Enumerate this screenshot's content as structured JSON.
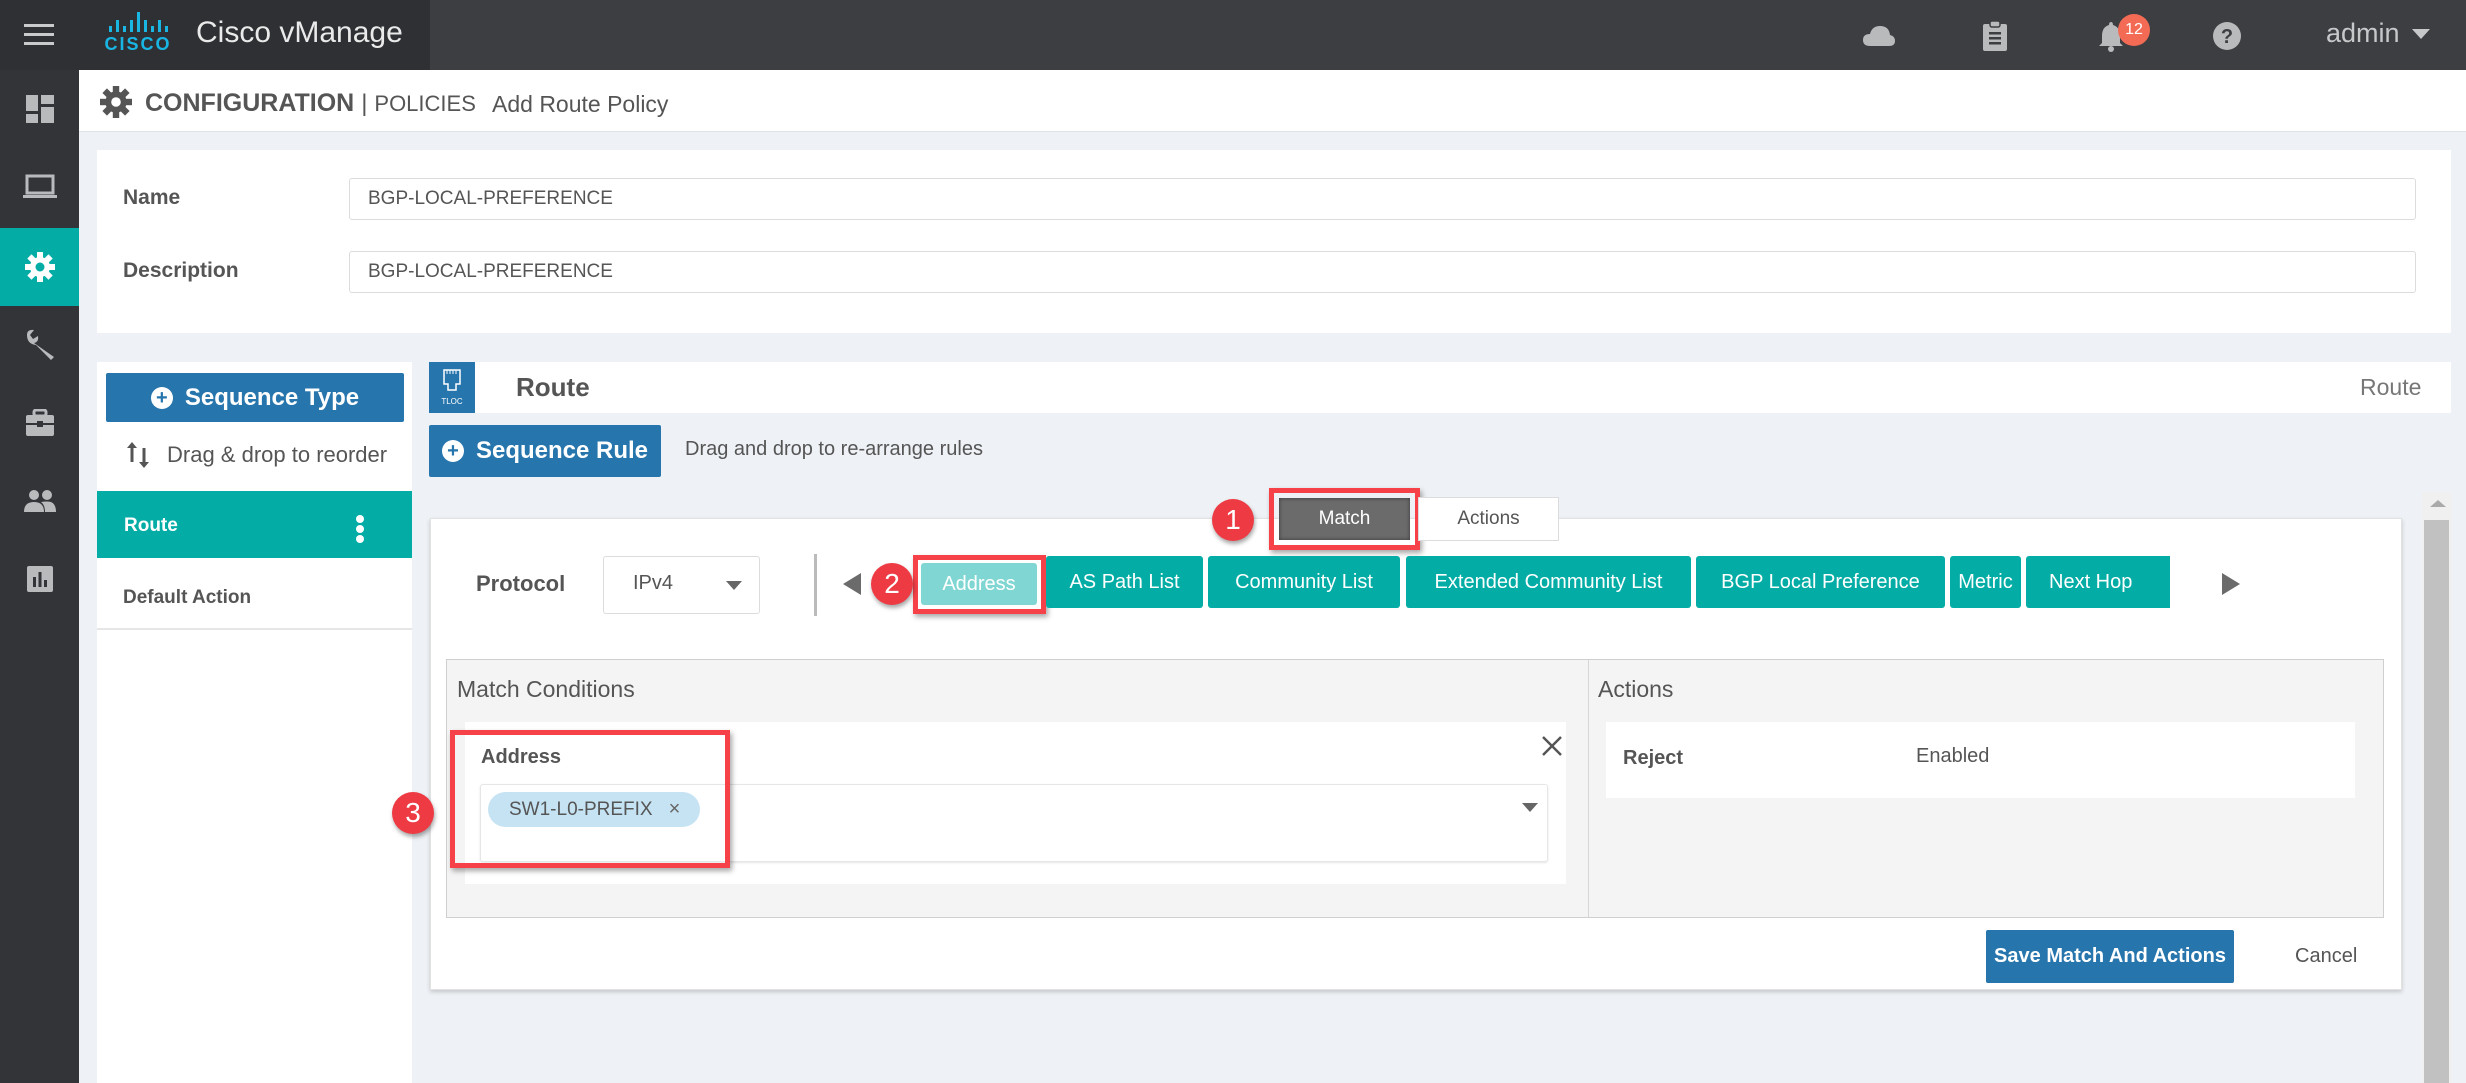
{
  "header": {
    "app_title": "Cisco vManage",
    "logo_word": "CISCO",
    "icons": [
      "cloud-icon",
      "clipboard-icon",
      "bell-icon",
      "help-icon"
    ],
    "notification_count": "12",
    "user": "admin"
  },
  "leftnav": {
    "items": [
      {
        "icon": "dashboard-icon",
        "active": false
      },
      {
        "icon": "monitor-icon",
        "active": false
      },
      {
        "icon": "gear-icon",
        "active": true
      },
      {
        "icon": "wrench-icon",
        "active": false
      },
      {
        "icon": "toolbox-icon",
        "active": false
      },
      {
        "icon": "users-icon",
        "active": false
      },
      {
        "icon": "analytics-icon",
        "active": false
      }
    ]
  },
  "breadcrumb": {
    "section": "CONFIGURATION",
    "separator": "|",
    "subsection": "POLICIES",
    "page": "Add Route Policy"
  },
  "form": {
    "name_label": "Name",
    "name_value": "BGP-LOCAL-PREFERENCE",
    "description_label": "Description",
    "description_value": "BGP-LOCAL-PREFERENCE"
  },
  "sequence_panel": {
    "sequence_type_button": "Sequence Type",
    "reorder_hint": "Drag & drop to reorder",
    "items": [
      {
        "label": "Route",
        "active": true
      },
      {
        "label": "Default Action",
        "active": false
      }
    ]
  },
  "route_section": {
    "icon_label": "TLOC",
    "title": "Route",
    "right_label": "Route",
    "sequence_rule_button": "Sequence Rule",
    "rearrange_hint": "Drag and drop to re-arrange rules"
  },
  "rule_editor": {
    "tabs": [
      {
        "label": "Match",
        "active": true
      },
      {
        "label": "Actions",
        "active": false
      }
    ],
    "protocol_label": "Protocol",
    "protocol_value": "IPv4",
    "match_buttons": [
      {
        "label": "Address",
        "selected": true
      },
      {
        "label": "AS Path List",
        "selected": false
      },
      {
        "label": "Community List",
        "selected": false
      },
      {
        "label": "Extended Community List",
        "selected": false
      },
      {
        "label": "BGP Local Preference",
        "selected": false
      },
      {
        "label": "Metric",
        "selected": false
      },
      {
        "label": "Next Hop",
        "selected": false
      }
    ],
    "match_conditions_title": "Match Conditions",
    "address_label": "Address",
    "address_values": [
      "SW1-L0-PREFIX"
    ],
    "actions_title": "Actions",
    "actions": [
      {
        "label": "Reject",
        "value": "Enabled"
      }
    ],
    "save_button": "Save Match And Actions",
    "cancel_button": "Cancel"
  },
  "annotations": {
    "step1": "1",
    "step2": "2",
    "step3": "3",
    "highlight_color": "#f64148"
  },
  "colors": {
    "teal": "#04aca6",
    "blue": "#2675ac",
    "header": "#3d3e41"
  }
}
